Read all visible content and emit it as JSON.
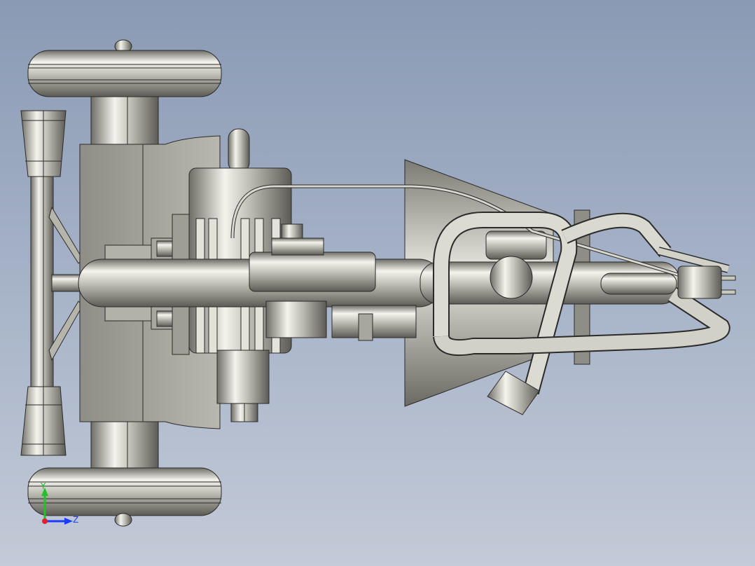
{
  "viewport": {
    "background_top": "#8a9ab4",
    "background_bottom": "#c3cad8"
  },
  "model": {
    "material_color": "#c9c8bd",
    "edge_color": "#2a2a2a"
  },
  "triad": {
    "y_label": "Y",
    "z_label": "Z",
    "y_color": "#22c02a",
    "z_color": "#1a3cff",
    "x_color": "#e0202a"
  }
}
